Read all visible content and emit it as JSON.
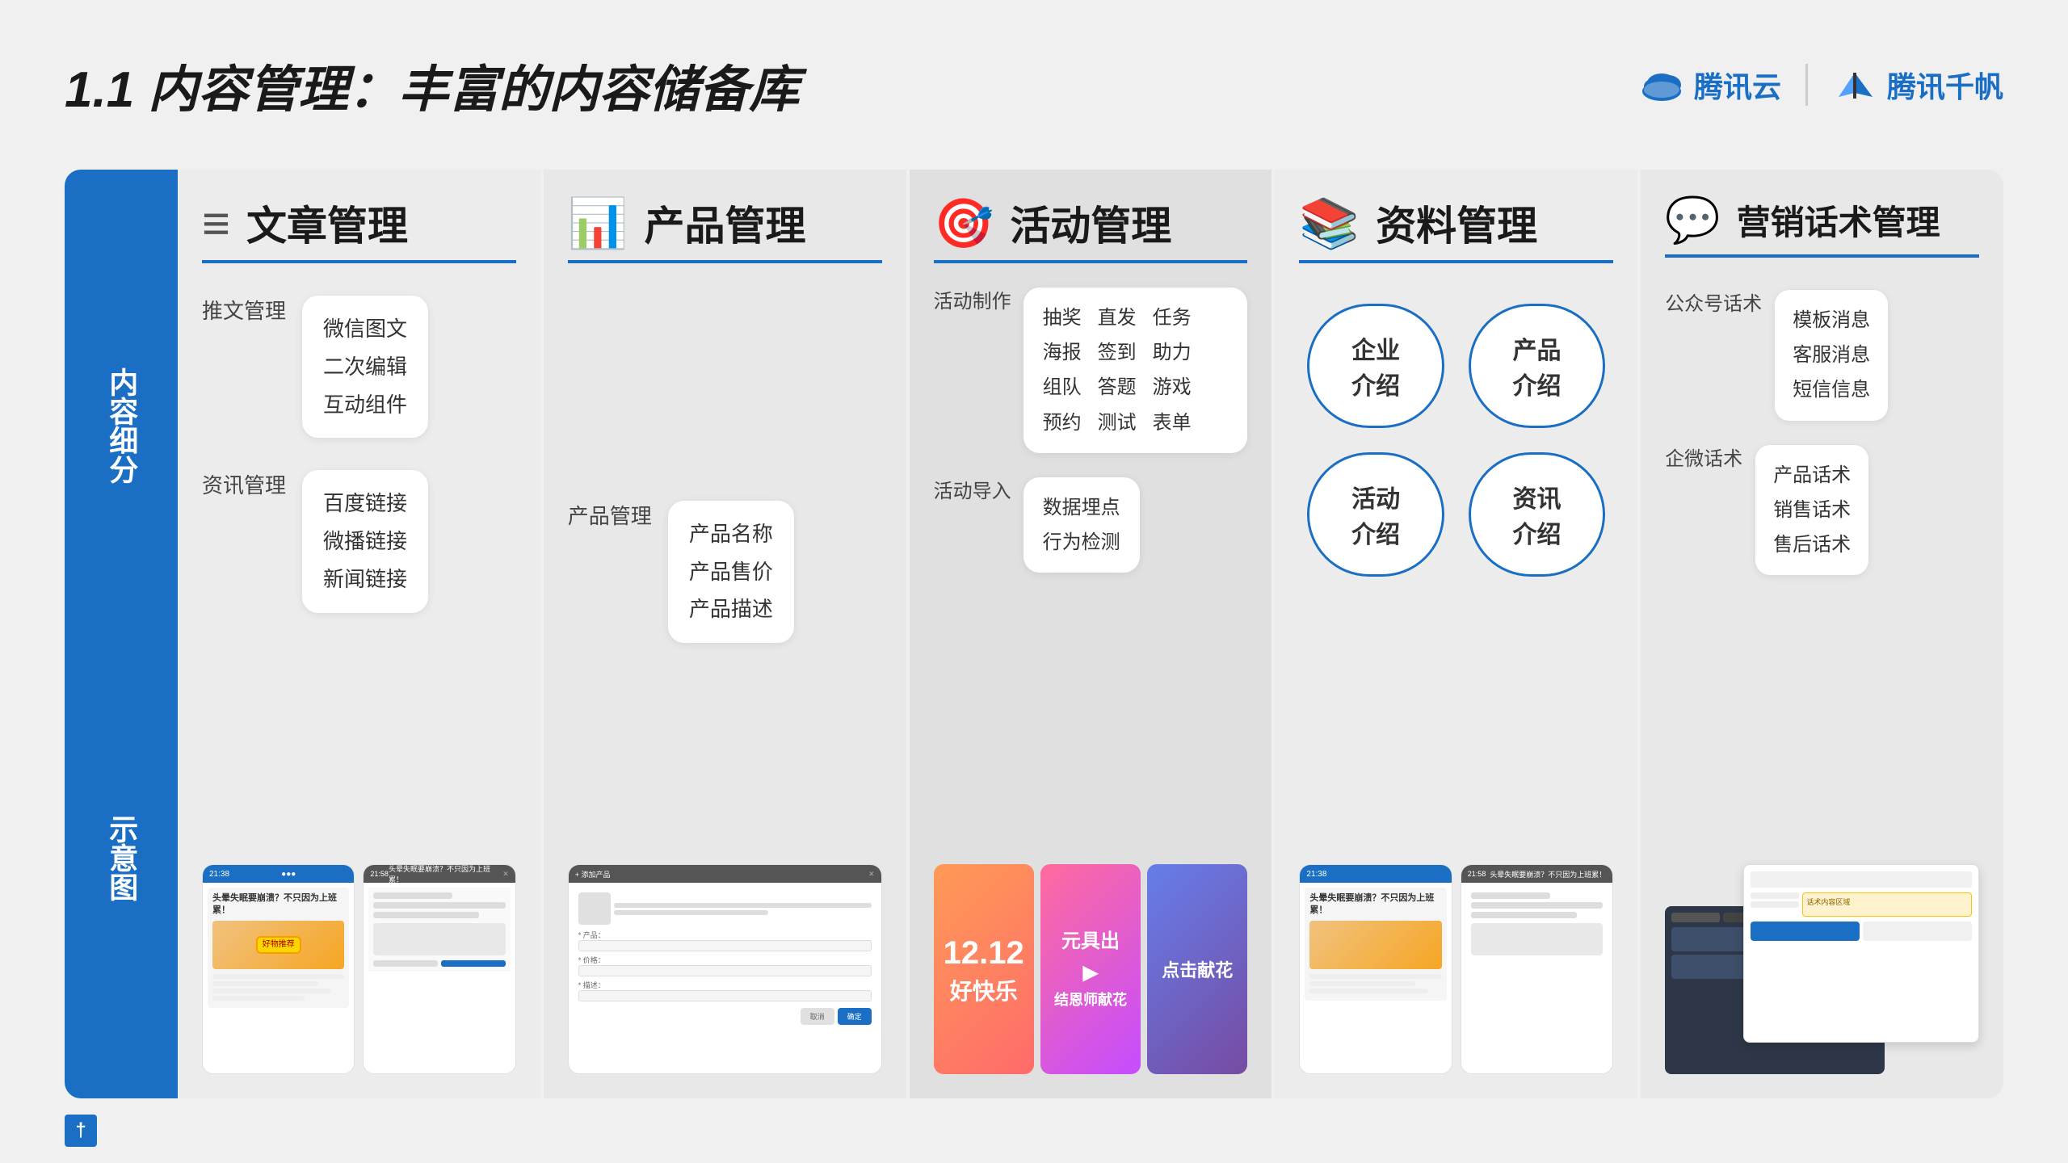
{
  "page": {
    "title": "1.1 内容管理：丰富的内容储备库",
    "background": "#f0f0f0"
  },
  "header": {
    "title_prefix": "1.1 内容管理：",
    "title_suffix": "丰富的内容储备库",
    "logo1_text": "腾讯云",
    "logo2_text": "腾讯千帆"
  },
  "sidebar": {
    "label1": "内容细分",
    "label2": "示意图"
  },
  "columns": [
    {
      "id": "article",
      "icon": "≡",
      "title": "文章管理",
      "items": [
        {
          "label": "推文管理",
          "bubble": "微信图文\n二次编辑\n互动组件"
        },
        {
          "label": "资讯管理",
          "bubble": "百度链接\n微播链接\n新闻链接"
        }
      ]
    },
    {
      "id": "product",
      "icon": "📊",
      "title": "产品管理",
      "items": [
        {
          "label": "产品管理",
          "bubble": "产品名称\n产品售价\n产品描述"
        }
      ]
    },
    {
      "id": "activity",
      "icon": "🎯",
      "title": "活动管理",
      "items": [
        {
          "label": "活动制作",
          "tags": [
            "抽奖",
            "直发",
            "任务",
            "海报",
            "签到",
            "助力",
            "组队",
            "答题",
            "游戏",
            "预约",
            "测试",
            "表单"
          ]
        },
        {
          "label": "活动导入",
          "bubble": "数据埋点\n行为检测"
        }
      ]
    },
    {
      "id": "material",
      "icon": "📚",
      "title": "资料管理",
      "ovals": [
        "企业介绍",
        "产品介绍",
        "活动介绍",
        "资讯介绍"
      ]
    },
    {
      "id": "marketing",
      "icon": "💬",
      "title": "营销话术管理",
      "items": [
        {
          "label": "公众号话术",
          "bubble": "模板消息\n客服消息\n短信信息"
        },
        {
          "label": "企微话术",
          "bubble": "产品话术\n销售话术\n售后话术"
        }
      ]
    }
  ],
  "labels": {
    "content_subdivision": "内容细分",
    "demo_diagram": "示意图"
  }
}
